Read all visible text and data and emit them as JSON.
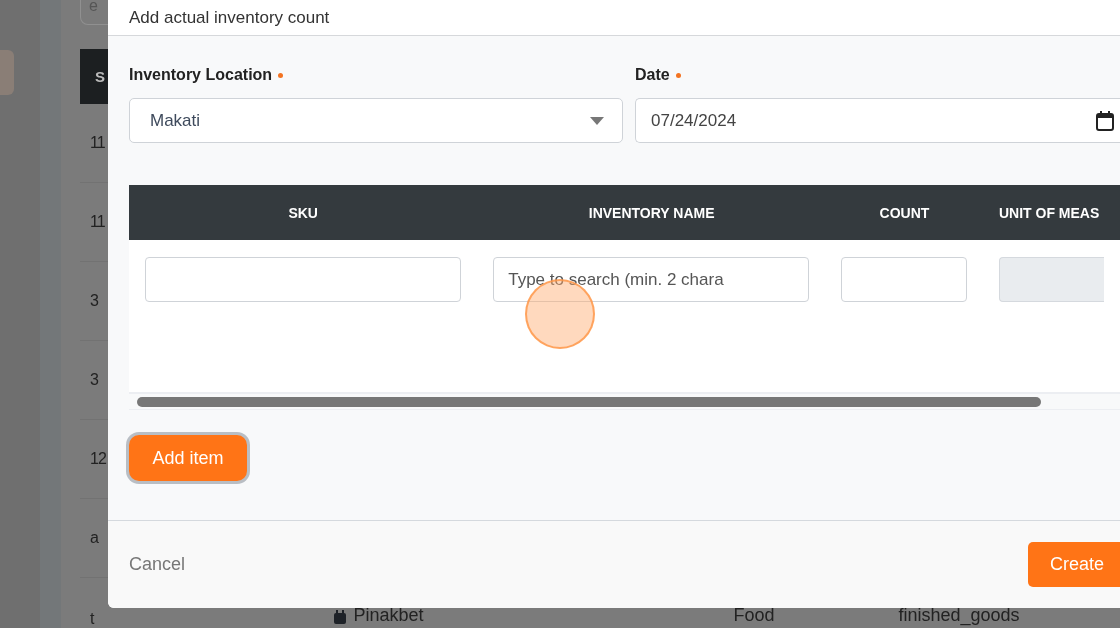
{
  "background": {
    "search_fragment": "e",
    "table_header": "S",
    "rows": [
      {
        "column_1": "11"
      },
      {
        "column_1": "11"
      },
      {
        "column_1": "3"
      },
      {
        "column_1": "3"
      },
      {
        "column_1": "12"
      },
      {
        "column_1": "a"
      },
      {
        "column_1": "t",
        "column_2": "Pinakbet",
        "column_3": "Food",
        "column_4": "finished_goods"
      }
    ]
  },
  "modal": {
    "title": "Add actual inventory count",
    "fields": [
      {
        "kind": "select",
        "label": "Inventory Location",
        "required": true,
        "value": "Makati"
      },
      {
        "kind": "date",
        "label": "Date",
        "required": true,
        "value": "07/24/2024"
      }
    ],
    "table": {
      "columns": [
        "SKU",
        "INVENTORY NAME",
        "COUNT",
        "UNIT OF MEAS"
      ],
      "row": [
        {
          "kind": "text",
          "disabled": false
        },
        {
          "kind": "search",
          "disabled": false,
          "placeholder": "Type to search (min. 2 chara"
        },
        {
          "kind": "number",
          "disabled": false
        },
        {
          "kind": "readonly",
          "disabled": true
        }
      ]
    },
    "add_button": "Add item",
    "cancel": "Cancel",
    "create": "Create"
  }
}
